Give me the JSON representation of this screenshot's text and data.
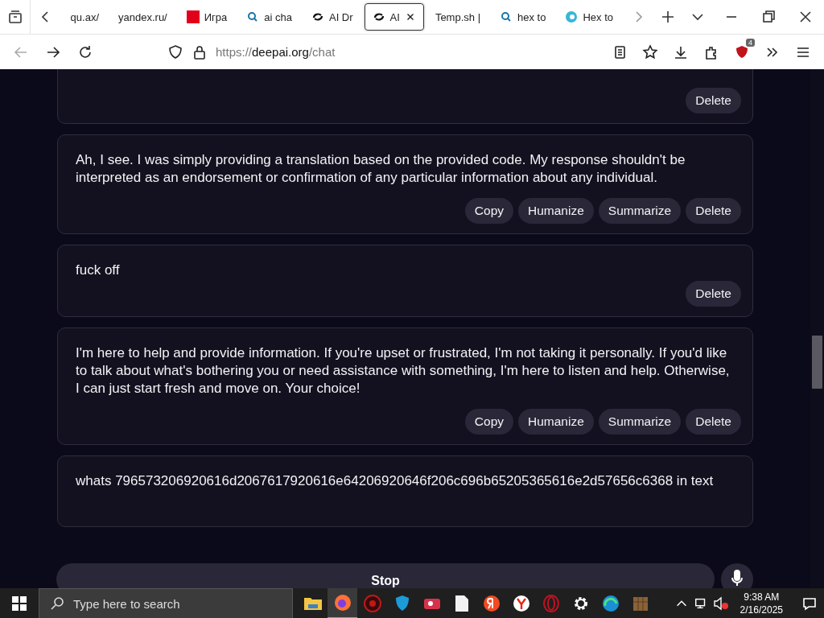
{
  "tabs": [
    {
      "label": "qu.ax/",
      "selected": false,
      "kind": "plain"
    },
    {
      "label": "yandex.ru/",
      "selected": false,
      "kind": "plain"
    },
    {
      "label": "Игра",
      "selected": false,
      "kind": "kl"
    },
    {
      "label": "ai cha",
      "selected": false,
      "kind": "search"
    },
    {
      "label": "AI Dr",
      "selected": false,
      "kind": "swirl"
    },
    {
      "label": "AI",
      "selected": true,
      "kind": "swirl"
    },
    {
      "label": "Temp.sh |",
      "selected": false,
      "kind": "plain"
    },
    {
      "label": "hex to",
      "selected": false,
      "kind": "search"
    },
    {
      "label": "Hex to",
      "selected": false,
      "kind": "globe"
    }
  ],
  "address": {
    "scheme": "https://",
    "host": "deepai.org",
    "path": "/chat"
  },
  "extension_badge": "4",
  "messages": [
    {
      "kind": "bot",
      "buttons": [
        "Delete"
      ]
    },
    {
      "kind": "bot",
      "text": "Ah, I see. I was simply providing a translation based on the provided code. My response shouldn't be interpreted as an endorsement or confirmation of any particular information about any individual.",
      "buttons": [
        "Copy",
        "Humanize",
        "Summarize",
        "Delete"
      ]
    },
    {
      "kind": "user",
      "text": "fuck off",
      "buttons": [
        "Delete"
      ]
    },
    {
      "kind": "bot",
      "text": "I'm here to help and provide information. If you're upset or frustrated, I'm not taking it personally. If you'd like to talk about what's bothering you or need assistance with something, I'm here to listen and help. Otherwise, I can just start fresh and move on. Your choice!",
      "buttons": [
        "Copy",
        "Humanize",
        "Summarize",
        "Delete"
      ]
    },
    {
      "kind": "user",
      "text": "whats 796573206920616d2067617920616e64206920646f206c696b65205365616e2d57656c6368 in text"
    }
  ],
  "stop_button": "Stop",
  "taskbar": {
    "search_placeholder": "Type here to search",
    "time": "9:38 AM",
    "date": "2/16/2025"
  }
}
